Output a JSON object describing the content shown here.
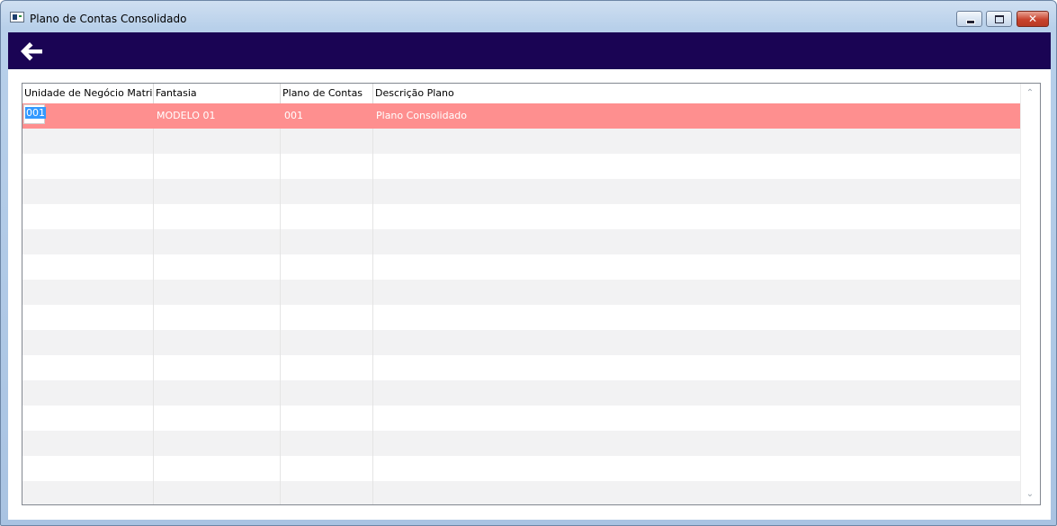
{
  "window": {
    "title": "Plano de Contas Consolidado",
    "controls": {
      "minimize": "minimize",
      "maximize": "maximize",
      "close": "✕"
    }
  },
  "toolbar": {
    "back_icon": "arrow-left-icon",
    "background": "#1a0454"
  },
  "grid": {
    "columns": [
      "Unidade de Negócio Matriz",
      "Fantasia",
      "Plano de Contas",
      "Descrição Plano"
    ],
    "rows": [
      {
        "unidade": "001",
        "fantasia": "MODELO 01",
        "plano": "001",
        "descricao": "Plano Consolidado",
        "selected": true
      }
    ],
    "empty_row_count": 16,
    "selection_color": "#fe8f8f",
    "alt_row_color": "#f2f2f3"
  }
}
